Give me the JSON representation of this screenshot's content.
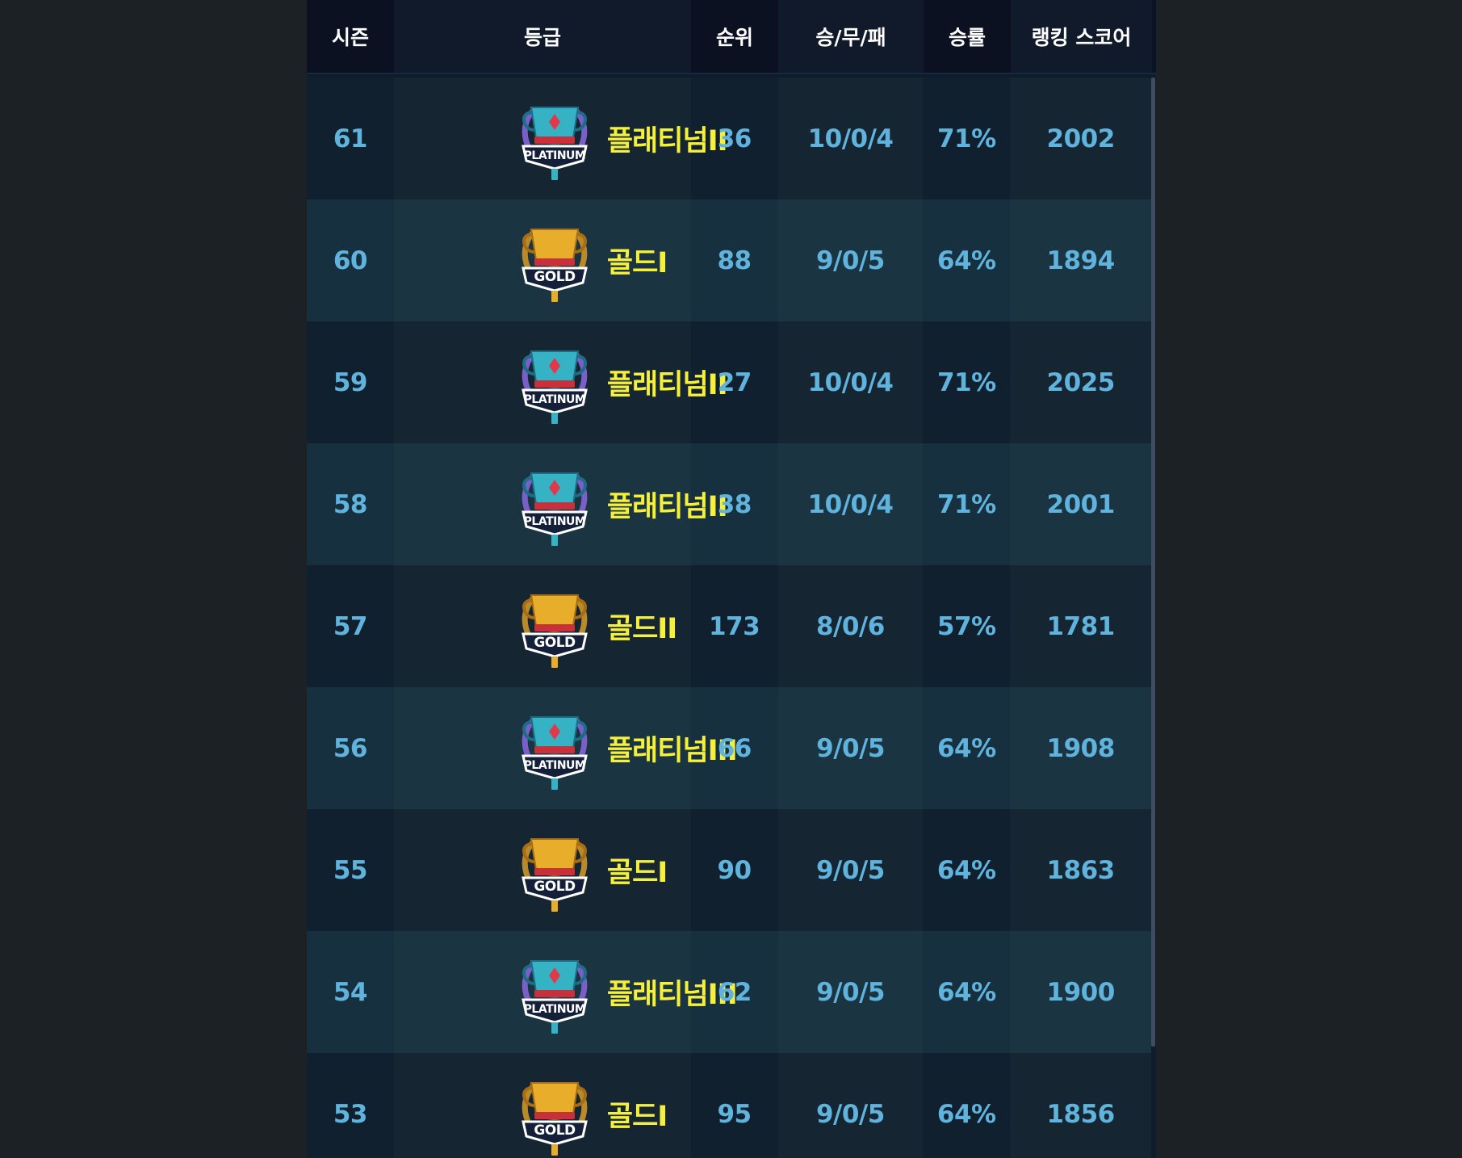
{
  "headers": {
    "season": "시즌",
    "grade": "등급",
    "rank": "순위",
    "record": "승/무/패",
    "win_rate": "승률",
    "ranking_score": "랭킹 스코어"
  },
  "colors": {
    "value_text": "#5fb3dc",
    "tier_text": "#f5f03c",
    "row_odd": "#10202e",
    "row_even": "#17303f"
  },
  "rows": [
    {
      "season": "61",
      "tier": "플래티넘II",
      "emblem": "platinum",
      "emblem_text": "PLATINUM",
      "rank": "36",
      "record": "10/0/4",
      "win_rate": "71%",
      "score": "2002"
    },
    {
      "season": "60",
      "tier": "골드I",
      "emblem": "gold",
      "emblem_text": "GOLD",
      "rank": "88",
      "record": "9/0/5",
      "win_rate": "64%",
      "score": "1894"
    },
    {
      "season": "59",
      "tier": "플래티넘II",
      "emblem": "platinum",
      "emblem_text": "PLATINUM",
      "rank": "27",
      "record": "10/0/4",
      "win_rate": "71%",
      "score": "2025"
    },
    {
      "season": "58",
      "tier": "플래티넘II",
      "emblem": "platinum",
      "emblem_text": "PLATINUM",
      "rank": "38",
      "record": "10/0/4",
      "win_rate": "71%",
      "score": "2001"
    },
    {
      "season": "57",
      "tier": "골드II",
      "emblem": "gold",
      "emblem_text": "GOLD",
      "rank": "173",
      "record": "8/0/6",
      "win_rate": "57%",
      "score": "1781"
    },
    {
      "season": "56",
      "tier": "플래티넘III",
      "emblem": "platinum",
      "emblem_text": "PLATINUM",
      "rank": "66",
      "record": "9/0/5",
      "win_rate": "64%",
      "score": "1908"
    },
    {
      "season": "55",
      "tier": "골드I",
      "emblem": "gold",
      "emblem_text": "GOLD",
      "rank": "90",
      "record": "9/0/5",
      "win_rate": "64%",
      "score": "1863"
    },
    {
      "season": "54",
      "tier": "플래티넘III",
      "emblem": "platinum",
      "emblem_text": "PLATINUM",
      "rank": "62",
      "record": "9/0/5",
      "win_rate": "64%",
      "score": "1900"
    },
    {
      "season": "53",
      "tier": "골드I",
      "emblem": "gold",
      "emblem_text": "GOLD",
      "rank": "95",
      "record": "9/0/5",
      "win_rate": "64%",
      "score": "1856"
    }
  ]
}
